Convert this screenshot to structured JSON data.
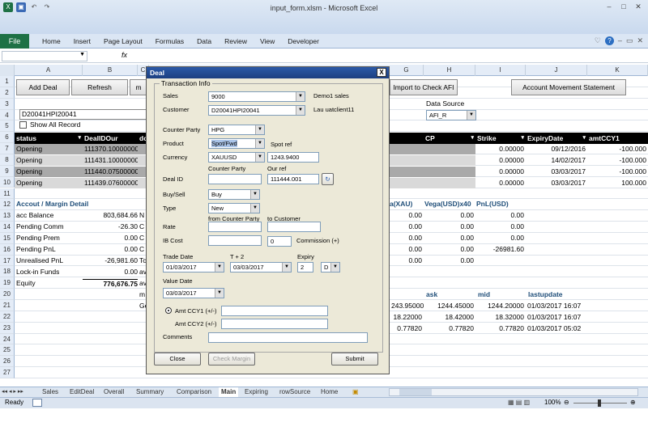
{
  "window": {
    "title": "input_form.xlsm - Microsoft Excel",
    "buttons": [
      "–",
      "□",
      "✕"
    ]
  },
  "ribbon": {
    "file": "File",
    "tabs": [
      "Home",
      "Insert",
      "Page Layout",
      "Formulas",
      "Data",
      "Review",
      "View",
      "Developer"
    ]
  },
  "formula_bar": {
    "fx": "fx"
  },
  "columns": [
    "A",
    "B",
    "C",
    "G",
    "H",
    "I",
    "J",
    "K"
  ],
  "rows": [
    "1",
    "2",
    "3",
    "4",
    "5",
    "6",
    "7",
    "8",
    "9",
    "10",
    "11",
    "12",
    "13",
    "14",
    "15",
    "16",
    "17",
    "18",
    "19",
    "20",
    "21",
    "22",
    "23",
    "24",
    "25",
    "26",
    "27"
  ],
  "sheet": {
    "add_deal": "Add Deal",
    "refresh": "Refresh",
    "m_cut": "m",
    "import_check": "Import to Check AFI",
    "account_movement": "Account Movement Statement",
    "client_code": "D20041HPI20041",
    "show_all": "Show All Record",
    "data_source_label": "Data Source",
    "data_source_value": "AFI_R",
    "table_headers": [
      "status",
      "DealIDOur",
      "do",
      "CP",
      "Strike",
      "ExpiryDate",
      "amtCCY1"
    ],
    "table_rows": [
      {
        "status": "Opening",
        "deal": "111370.1000000003",
        "do": "",
        "strike": "0.00000",
        "expiry": "09/12/2016",
        "amt": "-100.000"
      },
      {
        "status": "Opening",
        "deal": "111431.1000000003",
        "do": "",
        "strike": "0.00000",
        "expiry": "14/02/2017",
        "amt": "-100.000"
      },
      {
        "status": "Opening",
        "deal": "111440.0750000002",
        "do": "",
        "strike": "0.00000",
        "expiry": "03/03/2017",
        "amt": "-100.000"
      },
      {
        "status": "Opening",
        "deal": "111439.0760000002",
        "do": "",
        "strike": "0.00000",
        "expiry": "03/03/2017",
        "amt": "100.000"
      }
    ],
    "margin_title": "Accout / Margin Detail",
    "margin_rows": [
      {
        "label": "acc Balance",
        "value": "803,684.66",
        "c": "N"
      },
      {
        "label": "Pending Comm",
        "value": "-26.30",
        "c": "C"
      },
      {
        "label": "Pending Prem",
        "value": "0.00",
        "c": "C"
      },
      {
        "label": "Pending PnL",
        "value": "0.00",
        "c": "C"
      },
      {
        "label": "Unrealised PnL",
        "value": "-26,981.60",
        "c": "Tc"
      },
      {
        "label": "Lock-in Funds",
        "value": "0.00",
        "c": "av"
      },
      {
        "label": "Equity",
        "value": "776,676.75",
        "c": "av"
      }
    ],
    "row19_c": "m",
    "row21_c": "Ge",
    "vega_headers": [
      "a(XAU)",
      "Vega(USD)x40",
      "PnL(USD)"
    ],
    "vega_rows": [
      [
        "0.00",
        "0.00",
        "0.00"
      ],
      [
        "0.00",
        "0.00",
        "0.00"
      ],
      [
        "0.00",
        "0.00",
        "0.00"
      ],
      [
        "0.00",
        "0.00",
        "-26981.60"
      ],
      [
        "0.00",
        "0.00",
        ""
      ]
    ],
    "price_headers": [
      "ask",
      "mid",
      "lastupdate"
    ],
    "price_rows": [
      [
        "243.95000",
        "1244.45000",
        "1244.20000",
        "01/03/2017 16:07"
      ],
      [
        "18.22000",
        "18.42000",
        "18.32000",
        "01/03/2017 16:07"
      ],
      [
        "0.77820",
        "0.77820",
        "0.77820",
        "01/03/2017 05:02"
      ]
    ]
  },
  "dialog": {
    "title": "Deal",
    "close_x": "X",
    "frame_title": "Transaction Info",
    "sales_label": "Sales",
    "sales_value": "9000",
    "sales_note": "Demo1 sales",
    "customer_label": "Customer",
    "customer_value": "D20041HPI20041",
    "customer_note": "Lau uatclient11",
    "counter_party_label": "Counter Party",
    "counter_party_value": "HPG",
    "product_label": "Product",
    "product_value": "Spot/Fwd",
    "spot_ref_label": "Spot ref",
    "currency_label": "Currency",
    "currency_value": "XAUUSD",
    "spot_ref_value": "1243.9400",
    "counter_party2_label": "Counter Party",
    "our_ref_label": "Our ref",
    "deal_id_label": "Deal ID",
    "deal_id_value": "",
    "our_ref_value": "111444.001",
    "buysell_label": "Buy/Sell",
    "buysell_value": "Buy",
    "type_label": "Type",
    "type_value": "New",
    "from_cp_label": "from Counter Party",
    "to_customer_label": "to Customer",
    "rate_label": "Rate",
    "ib_cost_label": "IB Cost",
    "commission_value": "0",
    "commission_label": "Commission (+)",
    "trade_date_label": "Trade Date",
    "t2_label": "T + 2",
    "expiry_label": "Expiry",
    "trade_date_value": "01/03/2017",
    "t2_value": "03/03/2017",
    "expiry_value": "2",
    "expiry_unit": "D",
    "value_date_label": "Value Date",
    "value_date_value": "03/03/2017",
    "amt_ccy1_label": "Amt CCY1 (+/-)",
    "amt_ccy2_label": "Amt CCY2 (+/-)",
    "comments_label": "Comments",
    "close_button": "Close",
    "check_margin_button": "Check Margin",
    "submit_button": "Submit"
  },
  "sheet_tabs": [
    "Sales",
    "EditDeal",
    "Overall",
    "Summary",
    "Comparison",
    "Main",
    "Expiring",
    "rowSource",
    "Home"
  ],
  "active_tab": "Main",
  "status": {
    "ready": "Ready",
    "zoom": "100%"
  }
}
